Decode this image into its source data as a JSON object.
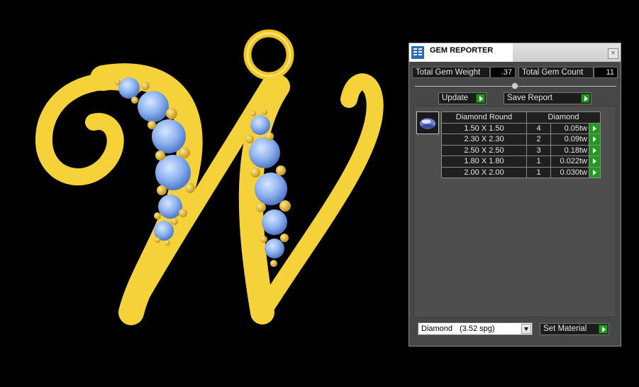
{
  "panel": {
    "title": "GEM REPORTER",
    "close_glyph": "×",
    "total_weight_label": "Total Gem Weight",
    "total_weight_value": ".37",
    "total_count_label": "Total Gem Count",
    "total_count_value": "11",
    "update_label": "Update",
    "save_label": "Save Report",
    "table": {
      "headers": [
        "Diamond Round",
        "Diamond"
      ],
      "rows": [
        {
          "size": "1.50 X 1.50",
          "qty": "4",
          "weight": "0.05tw"
        },
        {
          "size": "2.30 X 2.30",
          "qty": "2",
          "weight": "0.09tw"
        },
        {
          "size": "2.50 X 2.50",
          "qty": "3",
          "weight": "0.18tw"
        },
        {
          "size": "1.80 X 1.80",
          "qty": "1",
          "weight": "0.022tw"
        },
        {
          "size": "2.00 X 2.00",
          "qty": "1",
          "weight": "0.030tw"
        }
      ]
    },
    "material": {
      "name": "Diamond",
      "spg": "(3.52 spg)"
    },
    "set_material_label": "Set Material"
  },
  "colors": {
    "gold": "#f6d23a",
    "gem": "#8fb4f0",
    "panel_bg": "#474747",
    "action_green": "#1f9a1f"
  },
  "icons": [
    "app-icon",
    "close-icon",
    "arrow-right-icon",
    "dropdown-icon",
    "gem-icon"
  ]
}
